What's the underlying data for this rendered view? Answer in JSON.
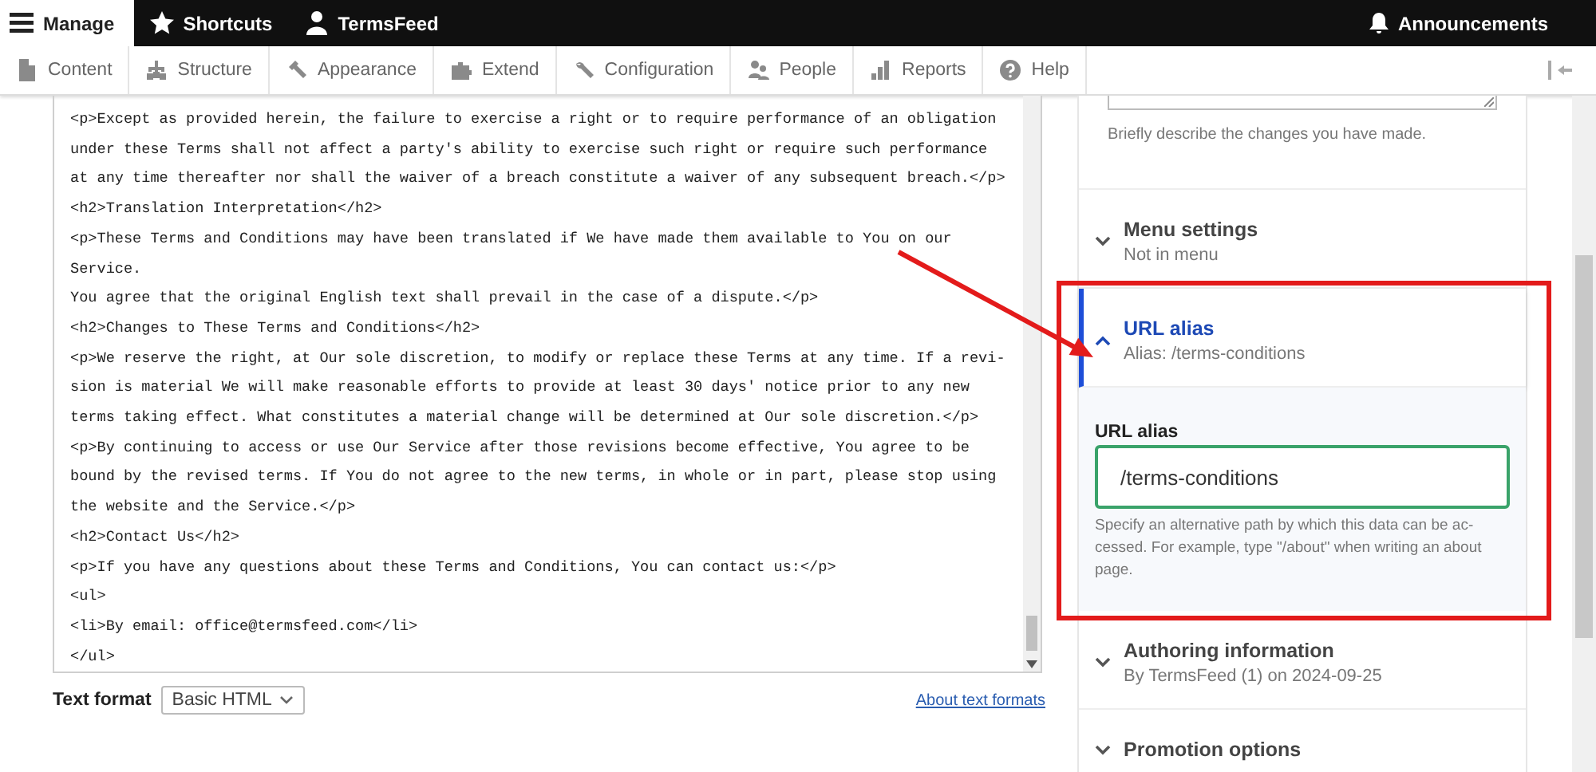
{
  "toolbar": {
    "items": [
      {
        "label": "Manage",
        "selected": true
      },
      {
        "label": "Shortcuts",
        "selected": false
      },
      {
        "label": "TermsFeed",
        "selected": false
      }
    ],
    "announcements": "Announcements"
  },
  "admin_menu": {
    "items": [
      "Content",
      "Structure",
      "Appearance",
      "Extend",
      "Configuration",
      "People",
      "Reports",
      "Help"
    ]
  },
  "editor": {
    "lines": [
      "<p>Except as provided herein, the failure to exercise a right or to require performance of an obligation",
      "under these Terms shall not affect a party's ability to exercise such right or require such performance",
      "at any time thereafter nor shall the waiver of a breach constitute a waiver of any subsequent breach.</p>",
      "<h2>Translation Interpretation</h2>",
      "<p>These Terms and Conditions may have been translated if We have made them available to You on our",
      "Service.",
      "You agree that the original English text shall prevail in the case of a dispute.</p>",
      "<h2>Changes to These Terms and Conditions</h2>",
      "<p>We reserve the right, at Our sole discretion, to modify or replace these Terms at any time. If a revi-",
      "sion is material We will make reasonable efforts to provide at least 30 days' notice prior to any new",
      "terms taking effect. What constitutes a material change will be determined at Our sole discretion.</p>",
      "<p>By continuing to access or use Our Service after those revisions become effective, You agree to be",
      "bound by the revised terms. If You do not agree to the new terms, in whole or in part, please stop using",
      "the website and the Service.</p>",
      "<h2>Contact Us</h2>",
      "<p>If you have any questions about these Terms and Conditions, You can contact us:</p>",
      "<ul>",
      "<li>By email: office@termsfeed.com</li>",
      "</ul>"
    ],
    "text_format": {
      "label": "Text format",
      "value": "Basic HTML"
    },
    "help_link": "About text formats"
  },
  "sidebar": {
    "revision_hint": "Briefly describe the changes you have made.",
    "sections": [
      {
        "title": "Menu settings",
        "summary": "Not in menu",
        "expanded": false
      },
      {
        "title": "URL alias",
        "summary": "Alias: /terms-conditions",
        "expanded": true,
        "field": {
          "label": "URL alias",
          "value": "/terms-conditions",
          "description": "Specify an alternative path by which this data can be ac-cessed. For example, type \"/about\" when writing an about page."
        }
      },
      {
        "title": "Authoring information",
        "summary": "By TermsFeed (1) on 2024-09-25",
        "expanded": false
      },
      {
        "title": "Promotion options",
        "expanded": false
      }
    ]
  }
}
